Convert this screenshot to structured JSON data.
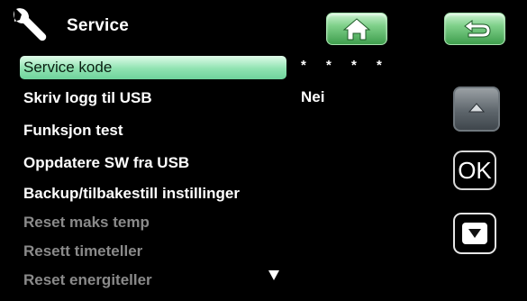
{
  "header": {
    "icon": "wrench-icon",
    "title": "Service",
    "home_icon": "home-icon",
    "back_icon": "return-arrow-icon",
    "button_color": "#5cbf6a"
  },
  "menu": {
    "items": [
      {
        "label": "Service kode",
        "value": "* * * *",
        "state": "selected"
      },
      {
        "label": "Skriv logg til USB",
        "value": "Nei",
        "state": "enabled"
      },
      {
        "label": "Funksjon test",
        "value": "",
        "state": "enabled"
      },
      {
        "label": "Oppdatere SW fra USB",
        "value": "",
        "state": "enabled"
      },
      {
        "label": "Backup/tilbakestill instillinger",
        "value": "",
        "state": "enabled"
      },
      {
        "label": "Reset maks temp",
        "value": "",
        "state": "disabled"
      },
      {
        "label": "Resett timeteller",
        "value": "",
        "state": "disabled"
      },
      {
        "label": "Reset energiteller",
        "value": "",
        "state": "disabled"
      }
    ],
    "more_indicator_icon": "triangle-down-icon"
  },
  "side_buttons": {
    "up_icon": "arrow-up-icon",
    "ok_label": "OK",
    "down_icon": "arrow-down-icon"
  },
  "colors": {
    "selection_highlight": "#8fe3b1",
    "disabled_text": "#8a8a8a",
    "background": "#000000"
  }
}
